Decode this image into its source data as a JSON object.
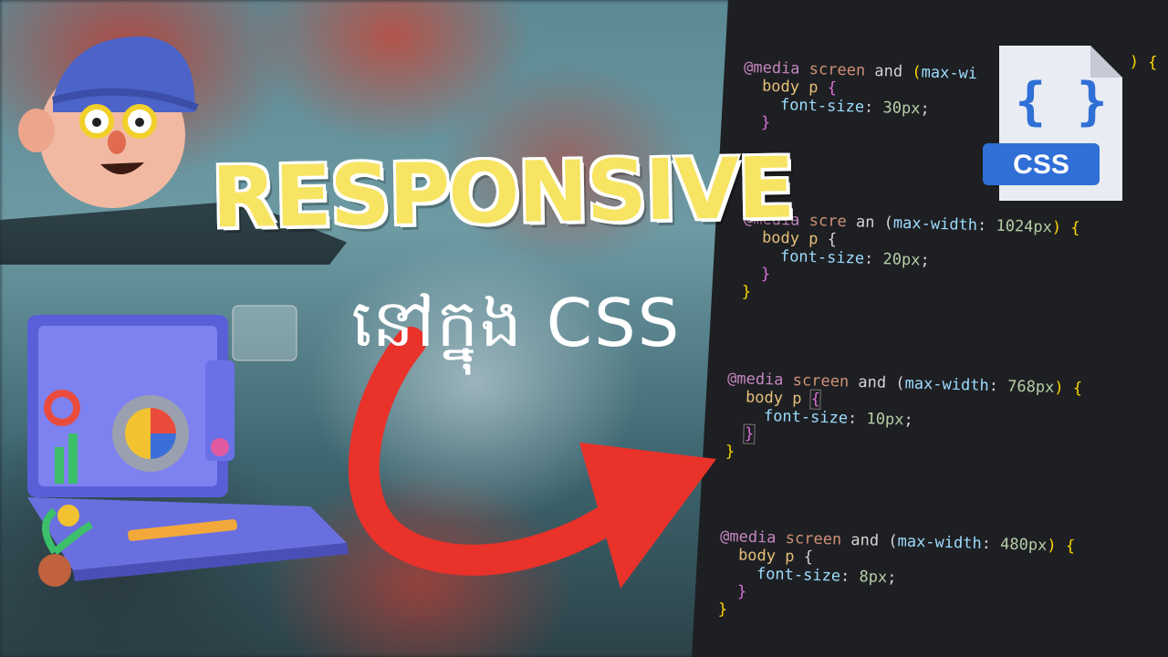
{
  "title": {
    "main": "RESPONSIVE",
    "sub": "នៅក្នុង CSS"
  },
  "css_badge": {
    "label": "CSS",
    "braces": "{ }"
  },
  "code": {
    "block1": {
      "media_kw": "@media",
      "screen": "screen",
      "and": "and",
      "open_paren": "(",
      "prop": "max-wi",
      "close": ") {",
      "selector": "body p",
      "brace_open": "{",
      "decl_prop": "font-size",
      "decl_val": "30px",
      "brace_close": "}"
    },
    "block2": {
      "media_kw": "@media",
      "screen": "scre",
      "and": "an",
      "prop": "max-width",
      "value": "1024px",
      "close": ") {",
      "selector": "body p",
      "decl_prop": "font-size",
      "decl_val": "20px",
      "brace_close_inner": "}",
      "brace_close_outer": "}"
    },
    "block3": {
      "media_kw": "@media",
      "screen": "screen",
      "and": "and",
      "prop": "max-width",
      "value": "768px",
      "close": ") {",
      "selector": "body p",
      "decl_prop": "font-size",
      "decl_val": "10px",
      "brace_close_inner": "}",
      "brace_close_outer": "}"
    },
    "block4": {
      "media_kw": "@media",
      "screen": "screen",
      "and": "and",
      "prop": "max-width",
      "value": "480px",
      "close": ") {",
      "selector": "body p",
      "decl_prop": "font-size",
      "decl_val": "8px",
      "brace_close_inner": "}",
      "brace_close_outer": "}"
    }
  },
  "colors": {
    "title_yellow": "#f7e463",
    "arrow_red": "#e8322a",
    "code_bg": "#1e1f22",
    "css_blue": "#2f6fd6"
  },
  "icons": [
    "cartoon-avatar-icon",
    "laptop-dashboard-icon",
    "css-file-icon",
    "red-arrow-icon"
  ]
}
